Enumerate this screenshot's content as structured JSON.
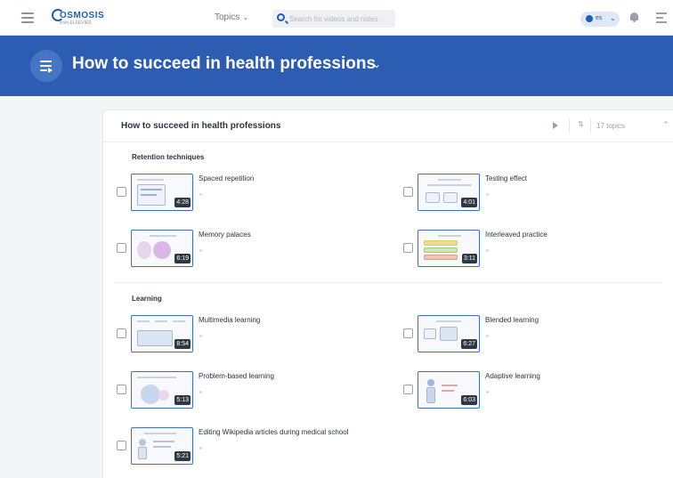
{
  "nav": {
    "logo_text": "OSMOSIS",
    "logo_sub": "from ELSEVIER",
    "topics_label": "Topics",
    "search_placeholder": "Search for videos and notes",
    "lang_code": "es"
  },
  "banner": {
    "title": "How to succeed in health professions"
  },
  "card": {
    "title": "How to succeed in health professions",
    "topic_count": "17 topics",
    "sections": [
      {
        "title": "Retention techniques",
        "videos": [
          {
            "title": "Spaced repetition",
            "duration": "4:28"
          },
          {
            "title": "Testing effect",
            "duration": "4:01"
          },
          {
            "title": "Memory palaces",
            "duration": "6:19"
          },
          {
            "title": "Interleaved practice",
            "duration": "3:11"
          }
        ]
      },
      {
        "title": "Learning",
        "videos": [
          {
            "title": "Multimedia learning",
            "duration": "8:54"
          },
          {
            "title": "Blended learning",
            "duration": "6:27"
          },
          {
            "title": "Problem-based learning",
            "duration": "5:13"
          },
          {
            "title": "Adaptive learning",
            "duration": "6:03"
          },
          {
            "title": "Editing Wikipedia articles during medical school",
            "duration": "5:21"
          }
        ]
      }
    ]
  },
  "colors": {
    "brand_blue": "#2d5db3",
    "thumb_border": "#3d6fc4"
  }
}
